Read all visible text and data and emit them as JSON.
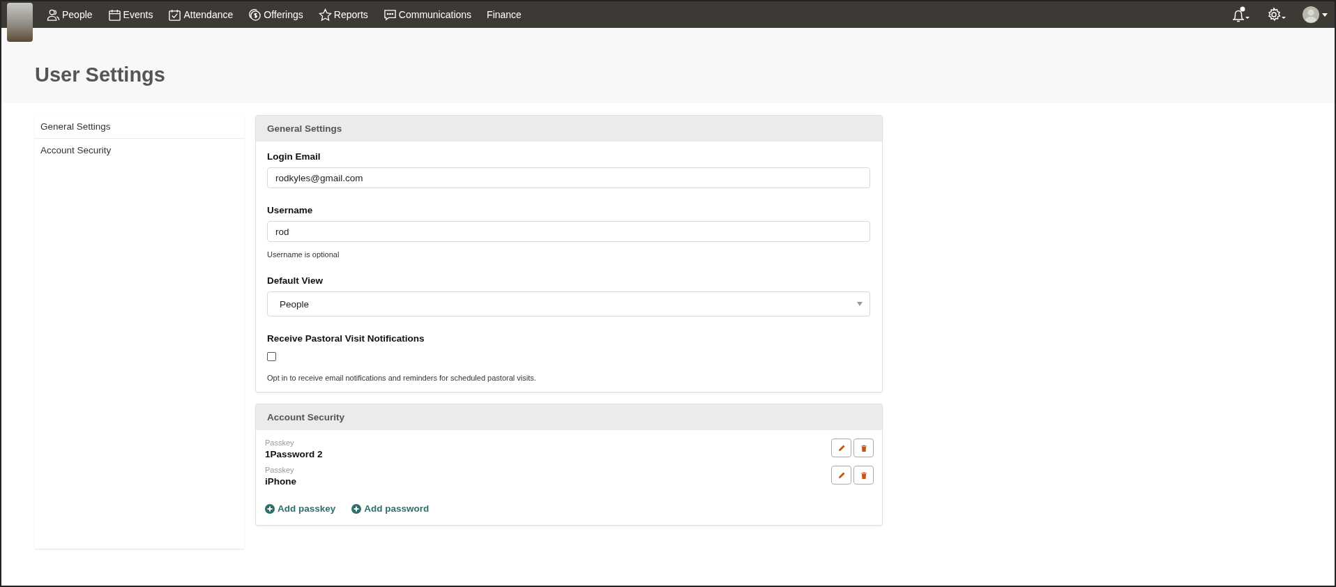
{
  "nav": {
    "items": [
      {
        "label": "People"
      },
      {
        "label": "Events"
      },
      {
        "label": "Attendance"
      },
      {
        "label": "Offerings"
      },
      {
        "label": "Reports"
      },
      {
        "label": "Communications"
      },
      {
        "label": "Finance"
      }
    ]
  },
  "page_title": "User Settings",
  "sidebar": {
    "items": [
      {
        "label": "General Settings"
      },
      {
        "label": "Account Security"
      }
    ]
  },
  "general": {
    "title": "General Settings",
    "login_email": {
      "label": "Login Email",
      "value": "rodkyles@gmail.com"
    },
    "username": {
      "label": "Username",
      "value": "rod",
      "hint": "Username is optional"
    },
    "default_view": {
      "label": "Default View",
      "value": "People"
    },
    "pastoral": {
      "label": "Receive Pastoral Visit Notifications",
      "checked": false,
      "hint": "Opt in to receive email notifications and reminders for scheduled pastoral visits."
    }
  },
  "security": {
    "title": "Account Security",
    "passkeys": [
      {
        "type": "Passkey",
        "name": "1Password 2"
      },
      {
        "type": "Passkey",
        "name": "iPhone"
      }
    ],
    "actions": [
      "Add passkey",
      "Add password"
    ]
  }
}
